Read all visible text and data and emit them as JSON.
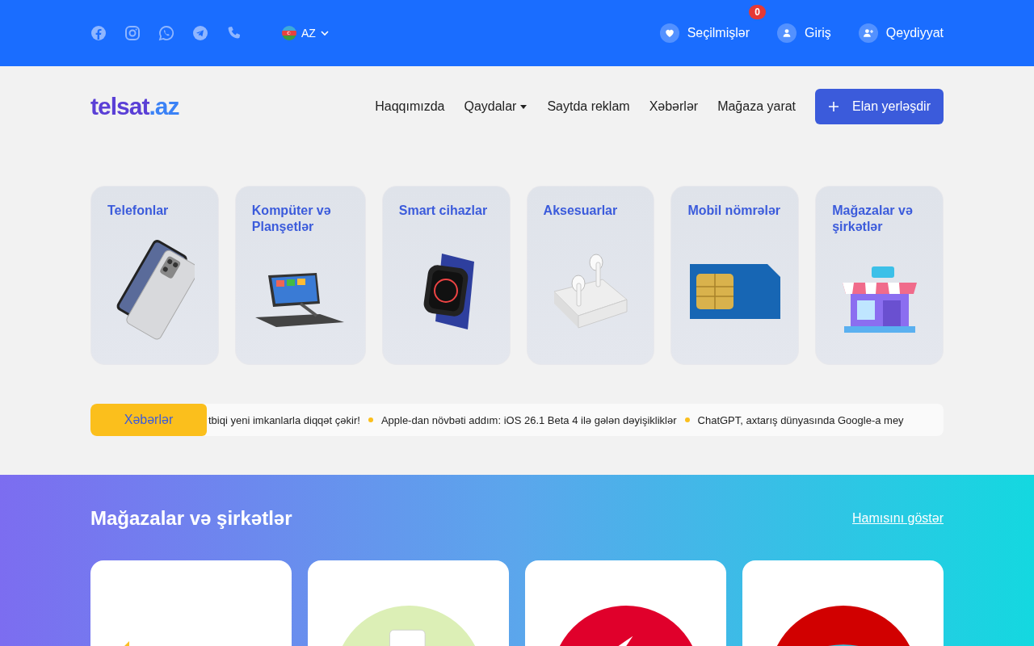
{
  "top_bar": {
    "language": "AZ",
    "links": [
      {
        "kind": "favorites",
        "label": "Seçilmişlər",
        "badge": "0"
      },
      {
        "kind": "login",
        "label": "Giriş"
      },
      {
        "kind": "register",
        "label": "Qeydiyyat"
      }
    ]
  },
  "header": {
    "logo": {
      "name": "telsat",
      "tld": ".az"
    },
    "nav": [
      {
        "label": "Haqqımızda",
        "dropdown": false
      },
      {
        "label": "Qaydalar",
        "dropdown": true
      },
      {
        "label": "Saytda reklam",
        "dropdown": false
      },
      {
        "label": "Xəbərlər",
        "dropdown": false
      },
      {
        "label": "Mağaza yarat",
        "dropdown": false
      }
    ],
    "cta": "Elan yerləşdir"
  },
  "categories": [
    {
      "name": "Telefonlar",
      "kind": "phone"
    },
    {
      "name": "Kompüter və Planşetlər",
      "kind": "laptop"
    },
    {
      "name": "Smart cihazlar",
      "kind": "watch"
    },
    {
      "name": "Aksesuarlar",
      "kind": "earbuds"
    },
    {
      "name": "Mobil nömrələr",
      "kind": "sim"
    },
    {
      "name": "Mağazalar və şirkətlər",
      "kind": "store"
    }
  ],
  "news_ticker": {
    "label": "Xəbərlər",
    "items": [
      "tbiqi yeni imkanlarla diqqət çəkir!",
      "Apple-dan növbəti addım: iOS 26.1 Beta 4 ilə gələn dəyişikliklər",
      "ChatGPT, axtarış dünyasında Google-a mey"
    ]
  },
  "stores_section": {
    "title": "Mağazalar və şirkətlər",
    "link": "Hamısını göstər",
    "stores": [
      {
        "kind": "blocks"
      },
      {
        "kind": "green"
      },
      {
        "kind": "red"
      },
      {
        "kind": "dark-red"
      }
    ]
  }
}
